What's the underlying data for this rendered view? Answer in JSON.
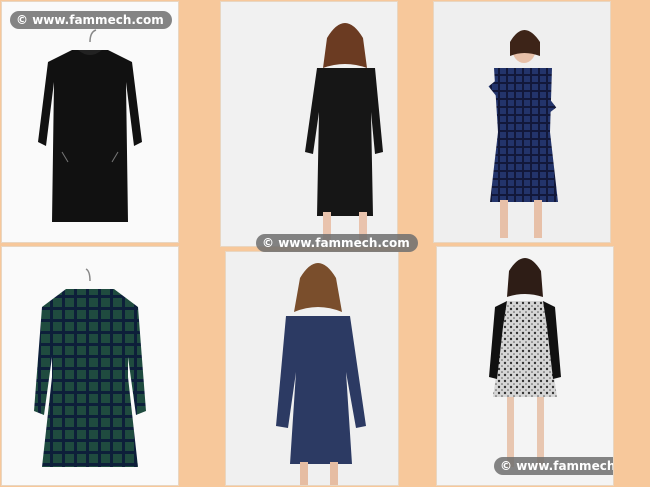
{
  "watermarks": [
    {
      "symbol": "©",
      "text": "www.fammech.com"
    },
    {
      "symbol": "©",
      "text": "www.fammech.com"
    },
    {
      "symbol": "©",
      "text": "www.fammech.com"
    }
  ],
  "products": [
    {
      "name": "black-long-sleeve-dress",
      "color": "#111111"
    },
    {
      "name": "black-shirt-dress-model",
      "color": "#161616"
    },
    {
      "name": "navy-check-shirt-dress-model",
      "color": "#23346b"
    },
    {
      "name": "green-tartan-shirt-dress",
      "color": "#1f4b3f"
    },
    {
      "name": "navy-shirt-dress-model",
      "color": "#2c3a63"
    },
    {
      "name": "grey-print-dress-model",
      "color": "#bdbdbd"
    }
  ],
  "colors": {
    "background": "#f7c89b",
    "tile": "#ffffff",
    "watermark_bg": "#6e6e6e"
  }
}
